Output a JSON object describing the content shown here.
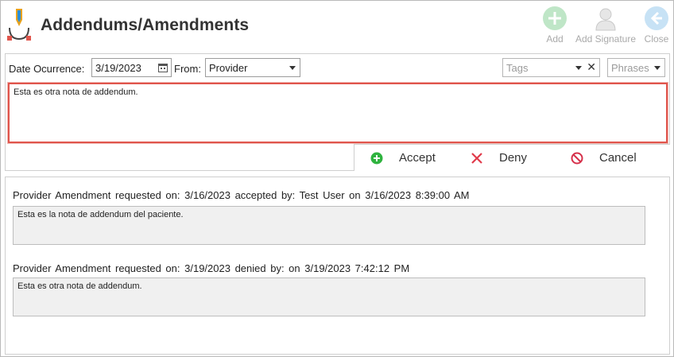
{
  "header": {
    "title": "Addendums/Amendments",
    "toolbar": {
      "add_label": "Add",
      "add_signature_label": "Add Signature",
      "close_label": "Close"
    }
  },
  "form": {
    "date_label": "Date Ocurrence:",
    "date_value": "3/19/2023",
    "from_label": "From:",
    "from_value": "Provider",
    "tags_placeholder": "Tags",
    "phrases_placeholder": "Phrases",
    "note_text": "Esta es otra nota de addendum."
  },
  "actions": {
    "accept_label": "Accept",
    "deny_label": "Deny",
    "cancel_label": "Cancel"
  },
  "history": [
    {
      "header": "Provider  Amendment  requested on:  3/16/2023 accepted by:  Test User  on  3/16/2023 8:39:00 AM",
      "note": "Esta es la nota de addendum del paciente."
    },
    {
      "header": "Provider  Amendment  requested on:  3/19/2023 denied by:    on  3/19/2023 7:42:12 PM",
      "note": "Esta es otra nota de addendum."
    }
  ],
  "colors": {
    "accent_red": "#e0554c",
    "accept_green": "#2fb33f",
    "deny_red": "#e03a4a",
    "toolbar_disabled": "#c8ead0"
  }
}
